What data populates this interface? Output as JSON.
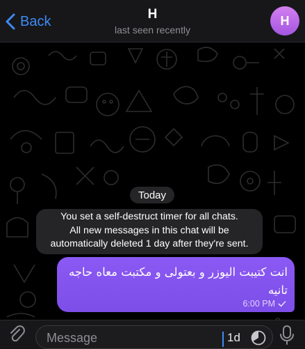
{
  "header": {
    "back_label": "Back",
    "contact_name": "H",
    "status": "last seen recently",
    "avatar_initial": "H"
  },
  "chat": {
    "date_label": "Today",
    "service_message_lines": [
      "You set a self-destruct timer for all chats.",
      "All new messages in this chat will be",
      "automatically deleted 1 day after they're sent."
    ],
    "messages": [
      {
        "text": "انت كتيبت اليوزر و بعتولى و مكتبت معاه حاجه تانيه",
        "time": "6:00 PM",
        "status_icon": "read-check-icon"
      }
    ]
  },
  "input": {
    "placeholder": "Message",
    "timer_label": "1d"
  },
  "colors": {
    "accent": "#3e8bf5",
    "bubble": "#8456f0",
    "avatar": "#c06ee8"
  },
  "icons": [
    "chevron-left-icon",
    "paperclip-icon",
    "self-destruct-timer-icon",
    "microphone-icon",
    "read-check-icon"
  ]
}
